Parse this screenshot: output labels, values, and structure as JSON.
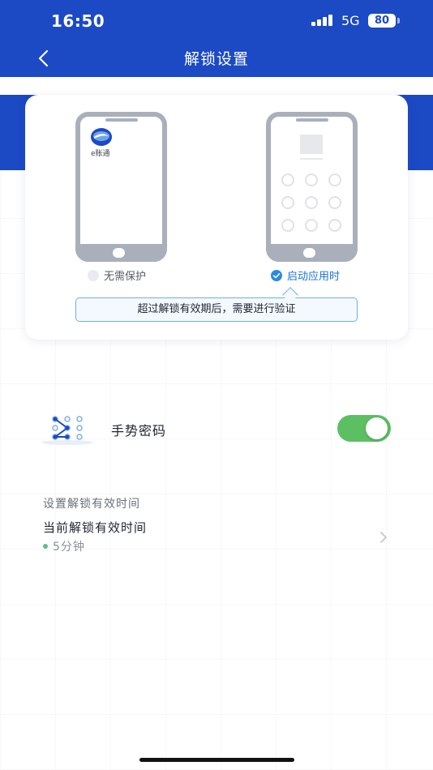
{
  "status_bar": {
    "time": "16:50",
    "network": "5G",
    "battery": "80"
  },
  "nav": {
    "title": "解锁设置"
  },
  "card": {
    "left_phone": {
      "app_name": "e账通"
    },
    "options": [
      {
        "label": "无需保护",
        "selected": false
      },
      {
        "label": "启动应用时",
        "selected": true
      }
    ],
    "hint": "超过解锁有效期后，需要进行验证"
  },
  "gesture": {
    "label": "手势密码",
    "enabled": true
  },
  "unlock_section": {
    "title": "设置解锁有效时间",
    "row_label": "当前解锁有效时间",
    "row_value": "5分钟"
  },
  "colors": {
    "primary": "#1c49c4",
    "toggle_on": "#5cbf62",
    "accent": "#2a8be0"
  }
}
